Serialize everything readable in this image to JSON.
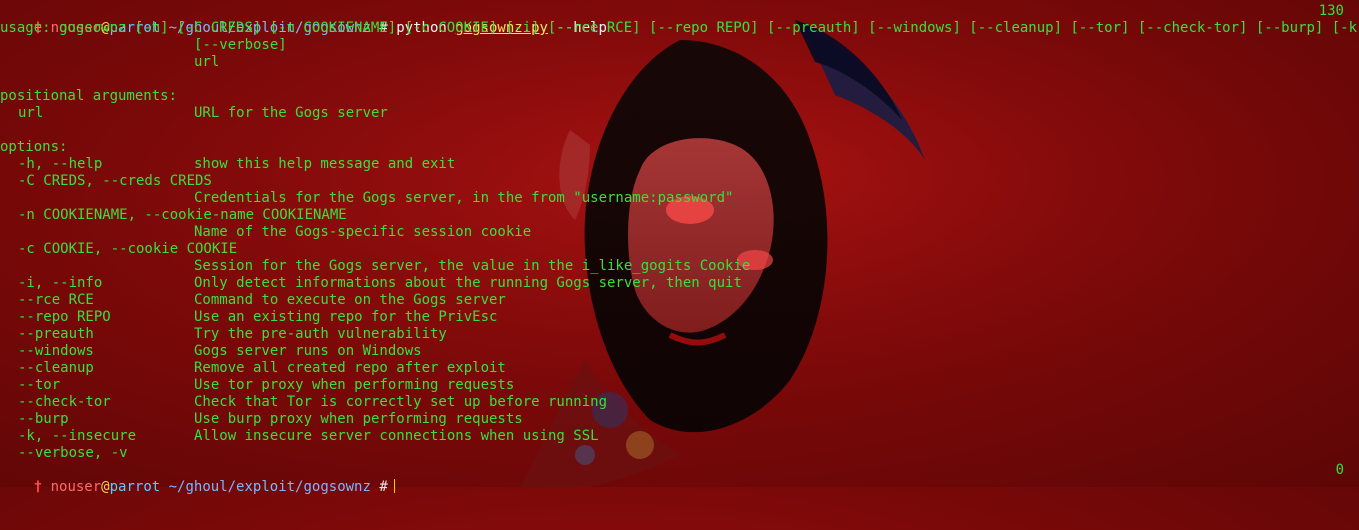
{
  "terminal": {
    "prompt_symbol": "†",
    "user": "nouser",
    "at": "@",
    "host": "parrot",
    "path": "~/ghoul/exploit/gogsownz",
    "hash": "#",
    "command_prefix": "python",
    "command_file": "gogsownz.py",
    "command_suffix": "--help",
    "exit_code_top": "130",
    "exit_code_bottom": "0",
    "usage_line_1": "usage: gogsownz [-h] [-C CREDS] [-n COOKIENAME] [-c COOKIE] [-i] [--rce RCE] [--repo REPO] [--preauth] [--windows] [--cleanup] [--tor] [--check-tor] [--burp] [-k]",
    "usage_line_2": "[--verbose]",
    "usage_line_3": "url",
    "section_positional": "positional arguments:",
    "positional_items": [
      {
        "name": "url",
        "desc": "URL for the Gogs server"
      }
    ],
    "section_options": "options:",
    "options": [
      {
        "name": "-h, --help",
        "desc": "show this help message and exit"
      },
      {
        "name": "-C CREDS, --creds CREDS",
        "desc": ""
      },
      {
        "name": "",
        "desc": "Credentials for the Gogs server, in the from \"username:password\""
      },
      {
        "name": "-n COOKIENAME, --cookie-name COOKIENAME",
        "desc": ""
      },
      {
        "name": "",
        "desc": "Name of the Gogs-specific session cookie"
      },
      {
        "name": "-c COOKIE, --cookie COOKIE",
        "desc": ""
      },
      {
        "name": "",
        "desc": "Session for the Gogs server, the value in the i_like_gogits Cookie"
      },
      {
        "name": "-i, --info",
        "desc": "Only detect informations about the running Gogs server, then quit"
      },
      {
        "name": "--rce RCE",
        "desc": "Command to execute on the Gogs server"
      },
      {
        "name": "--repo REPO",
        "desc": "Use an existing repo for the PrivEsc"
      },
      {
        "name": "--preauth",
        "desc": "Try the pre-auth vulnerability"
      },
      {
        "name": "--windows",
        "desc": "Gogs server runs on Windows"
      },
      {
        "name": "--cleanup",
        "desc": "Remove all created repo after exploit"
      },
      {
        "name": "--tor",
        "desc": "Use tor proxy when performing requests"
      },
      {
        "name": "--check-tor",
        "desc": "Check that Tor is correctly set up before running"
      },
      {
        "name": "--burp",
        "desc": "Use burp proxy when performing requests"
      },
      {
        "name": "-k, --insecure",
        "desc": "Allow insecure server connections when using SSL"
      },
      {
        "name": "--verbose, -v",
        "desc": ""
      }
    ]
  }
}
